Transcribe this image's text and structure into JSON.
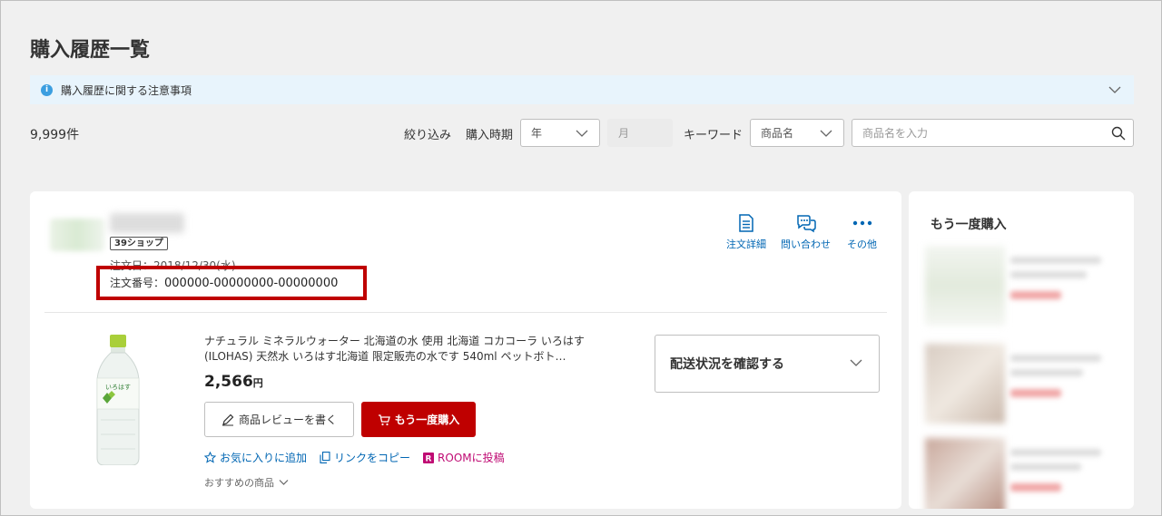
{
  "page": {
    "title": "購入履歴一覧"
  },
  "notice": {
    "text": "購入履歴に関する注意事項",
    "icon": "info-icon"
  },
  "summary": {
    "count": "9,999件"
  },
  "filters": {
    "filter_label": "絞り込み",
    "period_label": "購入時期",
    "year_placeholder": "年",
    "month_placeholder": "月",
    "keyword_label": "キーワード",
    "keyword_type": "商品名",
    "search_placeholder": "商品名を入力"
  },
  "order": {
    "shop_badge": "39ショップ",
    "order_date": "注文日：2018/12/30(水)",
    "order_number_label": "注文番号：",
    "order_number": "000000-00000000-00000000",
    "actions": {
      "detail": "注文詳細",
      "inquiry": "問い合わせ",
      "more": "その他"
    },
    "product": {
      "title": "ナチュラル ミネラルウォーター 北海道の水 使用 北海道 コカコーラ いろはす(ILOHAS) 天然水 いろはす北海道 限定販売の水です 540ml ペットボト…",
      "price": "2,566",
      "price_unit": "円",
      "image_label": "いろはす"
    },
    "buttons": {
      "review": "商品レビューを書く",
      "rebuy": "もう一度購入"
    },
    "links": {
      "favorite": "お気に入りに追加",
      "copy_link": "リンクをコピー",
      "room": "ROOMに投稿"
    },
    "recommend": "おすすめの商品",
    "delivery": "配送状況を確認する"
  },
  "sidebar": {
    "title": "もう一度購入"
  },
  "colors": {
    "brand_red": "#bf0000",
    "link_blue": "#0066b3",
    "notice_bg": "#e8f4fc",
    "room_pink": "#bf0a73"
  }
}
